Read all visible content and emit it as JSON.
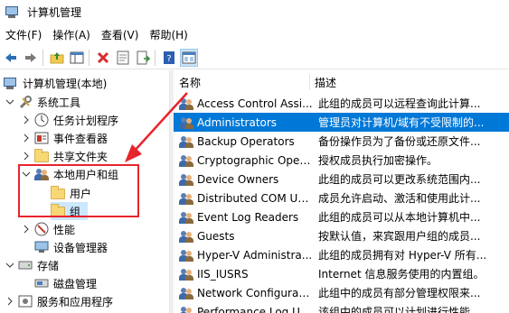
{
  "window": {
    "title": "计算机管理"
  },
  "menu": [
    "文件(F)",
    "操作(A)",
    "查看(V)",
    "帮助(H)"
  ],
  "toolbar": [
    {
      "name": "back-arrow-icon"
    },
    {
      "name": "forward-arrow-icon"
    },
    {
      "name": "up-folder-icon"
    },
    {
      "name": "show-hide-tree-icon"
    },
    {
      "name": "delete-icon"
    },
    {
      "name": "properties-icon"
    },
    {
      "name": "export-list-icon"
    },
    {
      "name": "help-icon"
    },
    {
      "name": "mmc-console-icon"
    }
  ],
  "tree": {
    "root": "计算机管理(本地)",
    "system_tools": "系统工具",
    "task_scheduler": "任务计划程序",
    "event_viewer": "事件查看器",
    "shared_folders": "共享文件夹",
    "local_users_groups": "本地用户和组",
    "users": "用户",
    "groups": "组",
    "performance": "性能",
    "device_manager": "设备管理器",
    "storage": "存储",
    "disk_management": "磁盘管理",
    "services_apps": "服务和应用程序"
  },
  "list": {
    "headers": {
      "name": "名称",
      "description": "描述"
    },
    "rows": [
      {
        "name": "Access Control Assi...",
        "description": "此组的成员可以远程查询此计算..."
      },
      {
        "name": "Administrators",
        "description": "管理员对计算机/域有不受限制的...",
        "selected": true
      },
      {
        "name": "Backup Operators",
        "description": "备份操作员为了备份或还原文件..."
      },
      {
        "name": "Cryptographic Oper...",
        "description": "授权成员执行加密操作。"
      },
      {
        "name": "Device Owners",
        "description": "此组的成员可以更改系统范围内..."
      },
      {
        "name": "Distributed COM Us...",
        "description": "成员允许启动、激活和使用此计..."
      },
      {
        "name": "Event Log Readers",
        "description": "此组的成员可以从本地计算机中..."
      },
      {
        "name": "Guests",
        "description": "按默认值，来宾跟用户组的成员..."
      },
      {
        "name": "Hyper-V Administra...",
        "description": "此组的成员拥有对 Hyper-V 所有..."
      },
      {
        "name": "IIS_IUSRS",
        "description": "Internet 信息服务使用的内置组。"
      },
      {
        "name": "Network Configurat...",
        "description": "此组中的成员有部分管理权限来..."
      },
      {
        "name": "Performance Log Us...",
        "description": "该组中的成员可以计划进行性能..."
      }
    ]
  },
  "colors": {
    "selection": "#0078d7",
    "highlight_box": "#e8242c",
    "tree_selected": "#cce8ff"
  }
}
